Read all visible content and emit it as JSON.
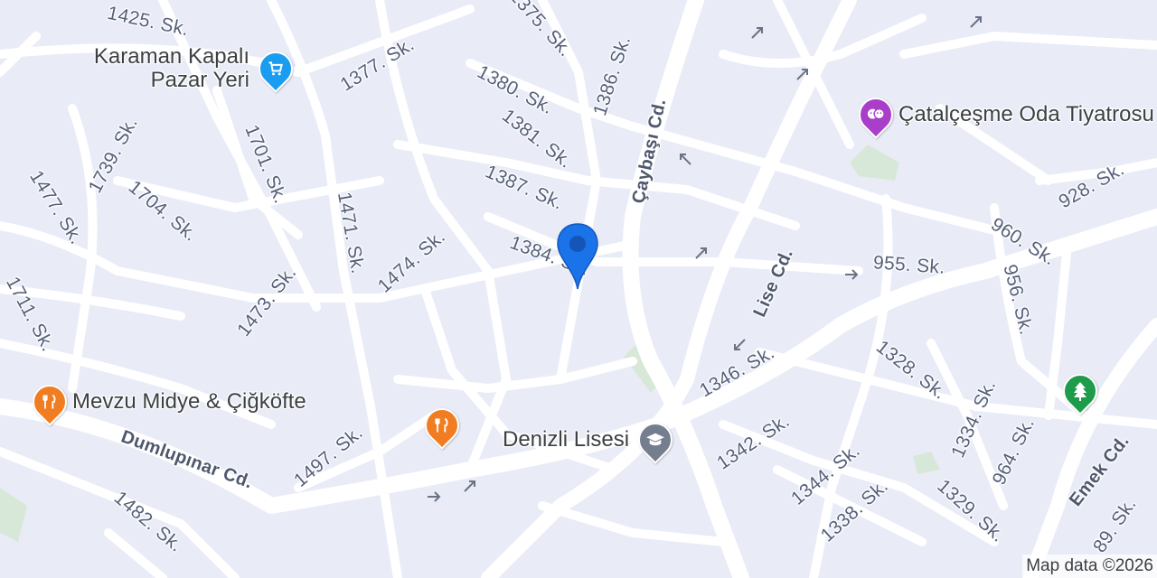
{
  "map": {
    "background_color": "#e9ecf7",
    "road_color": "#ffffff",
    "park_color": "#d6ead5",
    "attribution": "Map data ©2026"
  },
  "streets": {
    "s1425": "1425. Sk.",
    "s1375": "1375. Sk.",
    "s1377": "1377. Sk.",
    "s1380": "1380. Sk.",
    "s1386": "1386. Sk.",
    "s1381": "1381. Sk.",
    "caybasi": "Çaybaşı Cd.",
    "s1739": "1739. Sk.",
    "s1701": "1701. Sk.",
    "s1704": "1704. Sk.",
    "s1477": "1477. Sk.",
    "s1387": "1387. Sk.",
    "s1471": "1471. Sk.",
    "s1384": "1384. Sk.",
    "s1474": "1474. Sk.",
    "s1473": "1473. Sk.",
    "s1711": "1711. Sk.",
    "s928": "928. Sk.",
    "s960": "960. Sk.",
    "s955": "955. Sk.",
    "lise": "Lise Cd.",
    "s956": "956. Sk.",
    "s1328": "1328. Sk.",
    "s1346": "1346. Sk.",
    "s1334": "1334. Sk.",
    "s964": "964. Sk.",
    "s1342": "1342. Sk.",
    "s1497": "1497. Sk.",
    "dumlupinar": "Dumlupınar Cd.",
    "s1344": "1344. Sk.",
    "s1338": "1338. Sk.",
    "s1329": "1329. Sk.",
    "emek": "Emek Cd.",
    "s1482": "1482. Sk.",
    "s89": "89. Sk."
  },
  "pois": {
    "karaman": {
      "name": "Karaman Kapalı Pazar Yeri",
      "icon": "shopping-cart-icon",
      "color": "#1a9cf0"
    },
    "catalcesme": {
      "name": "Çatalçeşme Oda Tiyatrosu",
      "icon": "theater-masks-icon",
      "color": "#a93ec9"
    },
    "mevzu": {
      "name": "Mevzu Midye & Çiğköfte",
      "icon": "restaurant-icon",
      "color": "#f17d23"
    },
    "restaurant2": {
      "icon": "restaurant-icon",
      "color": "#f17d23"
    },
    "denizli": {
      "name": "Denizli Lisesi",
      "icon": "school-icon",
      "color": "#757e8e"
    },
    "park": {
      "icon": "tree-icon",
      "color": "#1e9b4b"
    }
  },
  "pin": {
    "color": "#1a73e8",
    "icon": "location-pin-icon"
  }
}
